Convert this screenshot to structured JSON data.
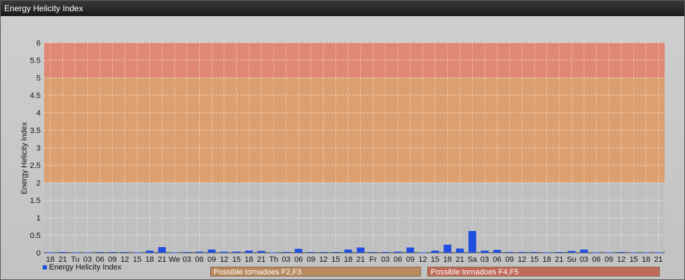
{
  "window": {
    "title": "Energy Helicity Index"
  },
  "legend": {
    "series_label": "Energy Helicity Index",
    "marker_color": "#1f4fe0"
  },
  "zones": [
    {
      "label": "Possible tornadoes F2,F3",
      "color": "#b88a5e"
    },
    {
      "label": "Possible tornadoes F4,F5",
      "color": "#c06a5a"
    }
  ],
  "chart_data": {
    "type": "bar",
    "ylabel": "Energy Helicity Index",
    "ylim": [
      0,
      6
    ],
    "y_ticks": [
      "0",
      "0.5",
      "1",
      "1.5",
      "2",
      "2.5",
      "3",
      "3.5",
      "4",
      "4.5",
      "5",
      "5.5",
      "6"
    ],
    "bands": [
      {
        "from": 0,
        "to": 2,
        "color": "#c0c0c0"
      },
      {
        "from": 2,
        "to": 5,
        "color": "#dca070"
      },
      {
        "from": 5,
        "to": 6,
        "color": "#e08876"
      }
    ],
    "categories": [
      "18",
      "21",
      "Tu",
      "03",
      "06",
      "09",
      "12",
      "15",
      "18",
      "21",
      "We",
      "03",
      "06",
      "09",
      "12",
      "15",
      "18",
      "21",
      "Th",
      "03",
      "06",
      "09",
      "12",
      "15",
      "18",
      "21",
      "Fr",
      "03",
      "06",
      "09",
      "12",
      "15",
      "18",
      "21",
      "Sa",
      "03",
      "06",
      "09",
      "12",
      "15",
      "18",
      "21",
      "Su",
      "03",
      "06",
      "09",
      "12",
      "15",
      "18",
      "21"
    ],
    "series": [
      {
        "color": "#1f4fe0",
        "values": [
          0.01,
          0.02,
          0.01,
          0.01,
          0.02,
          0.02,
          0.02,
          0.01,
          0.06,
          0.16,
          0.01,
          0.02,
          0.03,
          0.09,
          0.03,
          0.03,
          0.06,
          0.05,
          0.01,
          0.02,
          0.11,
          0.02,
          0.02,
          0.02,
          0.09,
          0.15,
          0.02,
          0.02,
          0.03,
          0.15,
          0.01,
          0.06,
          0.23,
          0.12,
          0.62,
          0.06,
          0.08,
          0.02,
          0.02,
          0.02,
          0.01,
          0.02,
          0.05,
          0.09,
          0.01,
          0.01,
          0.02,
          0.01,
          0.01,
          0.01
        ]
      }
    ]
  }
}
